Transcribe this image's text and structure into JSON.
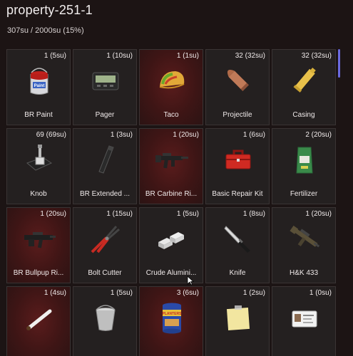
{
  "header": {
    "title": "property-251-1",
    "capacity": "307su / 2000su (15%)"
  },
  "colors": {
    "slot_bg": "#242020",
    "illegal_bg": "#3e1515",
    "scrollbar": "#6a6ae0"
  },
  "items": [
    {
      "qty": "1 (5su)",
      "label": "BR Paint",
      "icon": "paint-can-icon",
      "illegal": false
    },
    {
      "qty": "1 (10su)",
      "label": "Pager",
      "icon": "pager-icon",
      "illegal": false
    },
    {
      "qty": "1 (1su)",
      "label": "Taco",
      "icon": "taco-icon",
      "illegal": true
    },
    {
      "qty": "32 (32su)",
      "label": "Projectile",
      "icon": "projectile-icon",
      "illegal": false
    },
    {
      "qty": "32 (32su)",
      "label": "Casing",
      "icon": "casing-icon",
      "illegal": false
    },
    {
      "qty": "69 (69su)",
      "label": "Knob",
      "icon": "knob-icon",
      "illegal": false
    },
    {
      "qty": "1 (3su)",
      "label": "BR Extended ...",
      "icon": "magazine-icon",
      "illegal": false
    },
    {
      "qty": "1 (20su)",
      "label": "BR Carbine Ri...",
      "icon": "carbine-rifle-icon",
      "illegal": true
    },
    {
      "qty": "1 (6su)",
      "label": "Basic Repair Kit",
      "icon": "toolbox-icon",
      "illegal": false
    },
    {
      "qty": "2 (20su)",
      "label": "Fertilizer",
      "icon": "fertilizer-bag-icon",
      "illegal": false
    },
    {
      "qty": "1 (20su)",
      "label": "BR Bullpup Ri...",
      "icon": "bullpup-rifle-icon",
      "illegal": true
    },
    {
      "qty": "1 (15su)",
      "label": "Bolt Cutter",
      "icon": "bolt-cutter-icon",
      "illegal": false
    },
    {
      "qty": "1 (5su)",
      "label": "Crude Alumini...",
      "icon": "aluminium-ingots-icon",
      "illegal": false
    },
    {
      "qty": "1 (8su)",
      "label": "Knife",
      "icon": "knife-icon",
      "illegal": false
    },
    {
      "qty": "1 (20su)",
      "label": "H&K 433",
      "icon": "assault-rifle-icon",
      "illegal": false
    },
    {
      "qty": "1 (4su)",
      "label": "",
      "icon": "joint-icon",
      "illegal": true
    },
    {
      "qty": "1 (5su)",
      "label": "",
      "icon": "bucket-icon",
      "illegal": false
    },
    {
      "qty": "3 (6su)",
      "label": "",
      "icon": "peanuts-can-icon",
      "illegal": true
    },
    {
      "qty": "1 (2su)",
      "label": "",
      "icon": "sticky-note-icon",
      "illegal": false
    },
    {
      "qty": "1 (0su)",
      "label": "",
      "icon": "id-card-icon",
      "illegal": false
    }
  ],
  "icon_texts": {
    "paint": "Paint",
    "peanuts": "PLANTERS"
  }
}
